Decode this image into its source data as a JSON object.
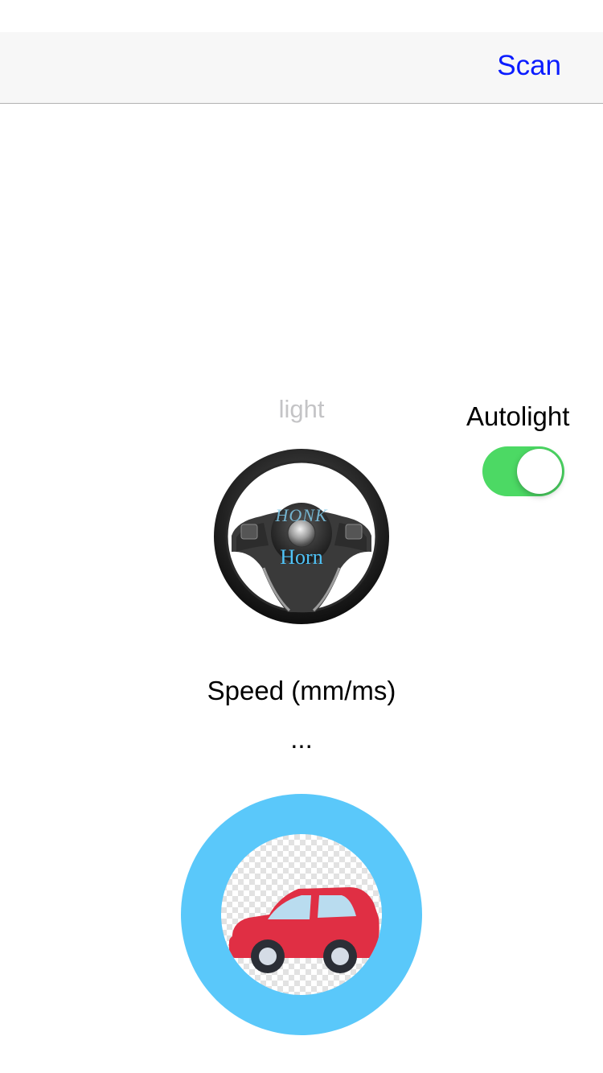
{
  "nav": {
    "scan_label": "Scan"
  },
  "controls": {
    "light_label": "light",
    "autolight_label": "Autolight",
    "autolight_on": true
  },
  "horn": {
    "honk_text": "HONK",
    "horn_text": "Horn"
  },
  "speed": {
    "title": "Speed (mm/ms)",
    "value": "..."
  },
  "colors": {
    "accent_blue": "#0a1cff",
    "switch_green": "#4cd964",
    "car_button_blue": "#5ac8fa",
    "car_red": "#e02f44"
  },
  "icons": {
    "steering_wheel": "steering-wheel-icon",
    "car": "car-icon"
  }
}
